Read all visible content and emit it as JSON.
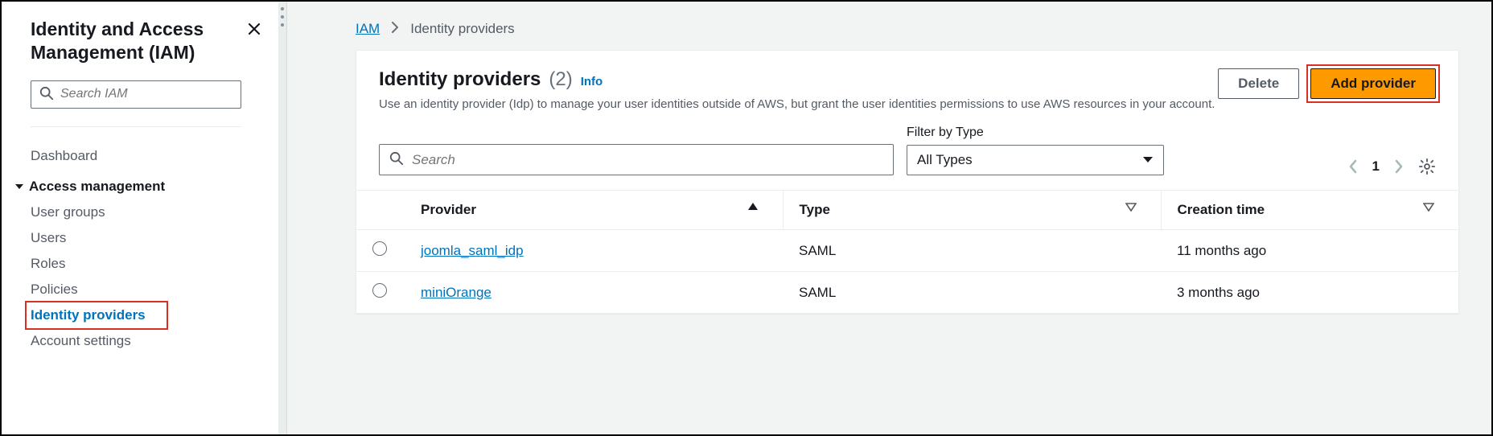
{
  "sidebar": {
    "title": "Identity and Access Management (IAM)",
    "search_placeholder": "Search IAM",
    "dashboard_label": "Dashboard",
    "section_label": "Access management",
    "items": [
      {
        "label": "User groups"
      },
      {
        "label": "Users"
      },
      {
        "label": "Roles"
      },
      {
        "label": "Policies"
      },
      {
        "label": "Identity providers"
      },
      {
        "label": "Account settings"
      }
    ]
  },
  "breadcrumb": {
    "root": "IAM",
    "current": "Identity providers"
  },
  "panel": {
    "title": "Identity providers",
    "count": "(2)",
    "info_label": "Info",
    "description": "Use an identity provider (Idp) to manage your user identities outside of AWS, but grant the user identities permissions to use AWS resources in your account.",
    "delete_label": "Delete",
    "add_label": "Add provider",
    "search_placeholder": "Search",
    "filter_label": "Filter by Type",
    "filter_selected": "All Types",
    "page_number": "1",
    "columns": {
      "provider": "Provider",
      "type": "Type",
      "creation": "Creation time"
    },
    "rows": [
      {
        "provider": "joomla_saml_idp",
        "type": "SAML",
        "creation": "11 months ago"
      },
      {
        "provider": "miniOrange",
        "type": "SAML",
        "creation": "3 months ago"
      }
    ]
  }
}
